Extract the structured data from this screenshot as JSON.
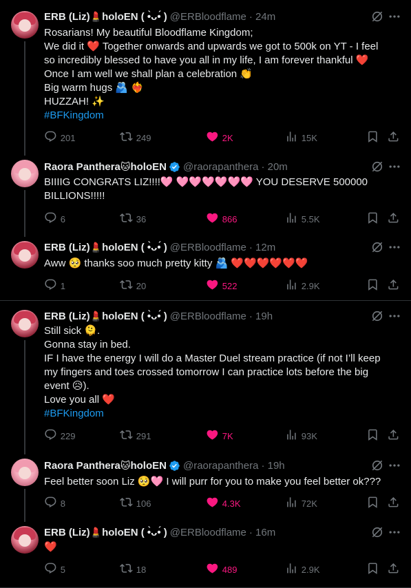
{
  "tweets": [
    {
      "author": "ERB (Liz)",
      "suffix": "holoEN (",
      "kaomoji": " •̀ᴗ•́ )",
      "handle": "@ERBloodflame",
      "time": "· 24m",
      "lines": [
        "Rosarians! My beautiful Bloodflame Kingdom;",
        "We did it ❤️ Together onwards and upwards we got to 500k on YT - I feel",
        "so incredibly blessed to have you all in my life, I am forever thankful ❤️",
        "Once I am well we shall plan a celebration 👏",
        "Big warm hugs 🫂 ❤️‍🔥",
        "HUZZAH! ✨"
      ],
      "hashtag": "#BFKingdom",
      "stats": {
        "replies": "201",
        "retweets": "249",
        "likes": "2K",
        "views": "15K"
      }
    },
    {
      "author": "Raora Panthera",
      "suffix": "holoEN",
      "handle": "@raorapanthera",
      "time": "· 20m",
      "lines": [
        "BIIIIG CONGRATS LIZ!!!!🩷 🩷🩷🩷🩷🩷🩷 YOU DESERVE 500000",
        "BILLIONS!!!!!"
      ],
      "stats": {
        "replies": "6",
        "retweets": "36",
        "likes": "866",
        "views": "5.5K"
      }
    },
    {
      "author": "ERB (Liz)",
      "suffix": "holoEN (",
      "kaomoji": " •̀ᴗ•́ )",
      "handle": "@ERBloodflame",
      "time": "· 12m",
      "lines": [
        "Aww 🥺 thanks soo much pretty kitty 🫂 ❤️❤️❤️❤️❤️❤️"
      ],
      "stats": {
        "replies": "1",
        "retweets": "20",
        "likes": "522",
        "views": "2.9K"
      }
    },
    {
      "author": "ERB (Liz)",
      "suffix": "holoEN (",
      "kaomoji": " •̀ᴗ•́ )",
      "handle": "@ERBloodflame",
      "time": "· 19h",
      "lines": [
        "Still sick 🫠.",
        "Gonna stay in bed.",
        "IF I have the energy I will do a Master Duel stream practice (if not I’ll keep",
        "my fingers and toes crossed tomorrow I can practice lots before the big",
        "event 😥).",
        "Love you all ❤️"
      ],
      "hashtag": "#BFKingdom",
      "stats": {
        "replies": "229",
        "retweets": "291",
        "likes": "7K",
        "views": "93K"
      }
    },
    {
      "author": "Raora Panthera",
      "suffix": "holoEN",
      "handle": "@raorapanthera",
      "time": "· 19h",
      "lines": [
        "Feel better soon Liz 🥺🩷 I will purr for you to make you feel better ok???"
      ],
      "stats": {
        "replies": "8",
        "retweets": "106",
        "likes": "4.3K",
        "views": "72K"
      }
    },
    {
      "author": "ERB (Liz)",
      "suffix": "holoEN (",
      "kaomoji": " •̀ᴗ•́ )",
      "handle": "@ERBloodflame",
      "time": "· 16m",
      "lines": [
        "❤️"
      ],
      "stats": {
        "replies": "5",
        "retweets": "18",
        "likes": "489",
        "views": "2.9K"
      }
    }
  ],
  "colors": {
    "background": "#000000",
    "text": "#e7e9ea",
    "muted": "#71767b",
    "link": "#1d9bf0",
    "like": "#f91880",
    "verified": "#1d9bf0"
  }
}
